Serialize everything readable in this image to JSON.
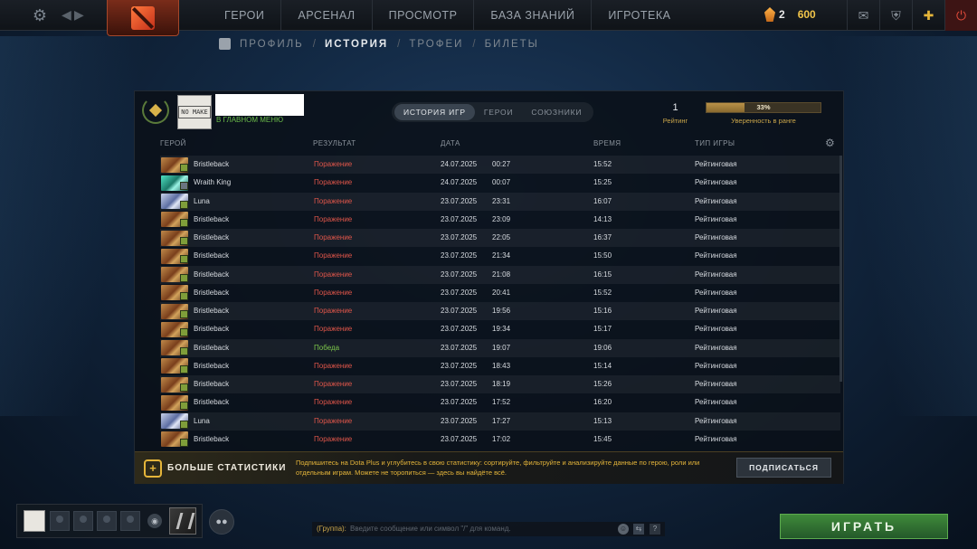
{
  "topbar": {
    "nav": [
      "ГЕРОИ",
      "АРСЕНАЛ",
      "ПРОСМОТР",
      "БАЗА ЗНАНИЙ",
      "ИГРОТЕКА"
    ],
    "shards_count": "2",
    "gold": "600"
  },
  "subnav": {
    "profile": "ПРОФИЛЬ",
    "history": "ИСТОРИЯ",
    "trophies": "ТРОФЕИ",
    "tickets": "БИЛЕТЫ",
    "sep": "/"
  },
  "player": {
    "status": "В ГЛАВНОМ МЕНЮ",
    "avatar_text": "NO MAKE"
  },
  "tabs": [
    "ИСТОРИЯ ИГР",
    "ГЕРОИ",
    "СОЮЗНИКИ"
  ],
  "rating": {
    "value": "1",
    "label": "Рейтинг"
  },
  "confidence": {
    "percent_text": "33%",
    "fraction": 0.33,
    "label": "Уверенность в ранге"
  },
  "columns": {
    "hero": "ГЕРОЙ",
    "result": "РЕЗУЛЬТАТ",
    "date": "ДАТА",
    "duration": "ВРЕМЯ",
    "type": "ТИП ИГРЫ"
  },
  "matches": [
    {
      "hero": "Bristleback",
      "img": "bristleback",
      "result": "Поражение",
      "win": false,
      "date": "24.07.2025",
      "time": "00:27",
      "duration": "15:52",
      "type": "Рейтинговая"
    },
    {
      "hero": "Wraith King",
      "img": "wraith",
      "result": "Поражение",
      "win": false,
      "date": "24.07.2025",
      "time": "00:07",
      "duration": "15:25",
      "type": "Рейтинговая"
    },
    {
      "hero": "Luna",
      "img": "luna",
      "result": "Поражение",
      "win": false,
      "date": "23.07.2025",
      "time": "23:31",
      "duration": "16:07",
      "type": "Рейтинговая"
    },
    {
      "hero": "Bristleback",
      "img": "bristleback",
      "result": "Поражение",
      "win": false,
      "date": "23.07.2025",
      "time": "23:09",
      "duration": "14:13",
      "type": "Рейтинговая"
    },
    {
      "hero": "Bristleback",
      "img": "bristleback",
      "result": "Поражение",
      "win": false,
      "date": "23.07.2025",
      "time": "22:05",
      "duration": "16:37",
      "type": "Рейтинговая"
    },
    {
      "hero": "Bristleback",
      "img": "bristleback",
      "result": "Поражение",
      "win": false,
      "date": "23.07.2025",
      "time": "21:34",
      "duration": "15:50",
      "type": "Рейтинговая"
    },
    {
      "hero": "Bristleback",
      "img": "bristleback",
      "result": "Поражение",
      "win": false,
      "date": "23.07.2025",
      "time": "21:08",
      "duration": "16:15",
      "type": "Рейтинговая"
    },
    {
      "hero": "Bristleback",
      "img": "bristleback",
      "result": "Поражение",
      "win": false,
      "date": "23.07.2025",
      "time": "20:41",
      "duration": "15:52",
      "type": "Рейтинговая"
    },
    {
      "hero": "Bristleback",
      "img": "bristleback",
      "result": "Поражение",
      "win": false,
      "date": "23.07.2025",
      "time": "19:56",
      "duration": "15:16",
      "type": "Рейтинговая"
    },
    {
      "hero": "Bristleback",
      "img": "bristleback",
      "result": "Поражение",
      "win": false,
      "date": "23.07.2025",
      "time": "19:34",
      "duration": "15:17",
      "type": "Рейтинговая"
    },
    {
      "hero": "Bristleback",
      "img": "bristleback",
      "result": "Победа",
      "win": true,
      "date": "23.07.2025",
      "time": "19:07",
      "duration": "19:06",
      "type": "Рейтинговая"
    },
    {
      "hero": "Bristleback",
      "img": "bristleback",
      "result": "Поражение",
      "win": false,
      "date": "23.07.2025",
      "time": "18:43",
      "duration": "15:14",
      "type": "Рейтинговая"
    },
    {
      "hero": "Bristleback",
      "img": "bristleback",
      "result": "Поражение",
      "win": false,
      "date": "23.07.2025",
      "time": "18:19",
      "duration": "15:26",
      "type": "Рейтинговая"
    },
    {
      "hero": "Bristleback",
      "img": "bristleback",
      "result": "Поражение",
      "win": false,
      "date": "23.07.2025",
      "time": "17:52",
      "duration": "16:20",
      "type": "Рейтинговая"
    },
    {
      "hero": "Luna",
      "img": "luna",
      "result": "Поражение",
      "win": false,
      "date": "23.07.2025",
      "time": "17:27",
      "duration": "15:13",
      "type": "Рейтинговая"
    },
    {
      "hero": "Bristleback",
      "img": "bristleback",
      "result": "Поражение",
      "win": false,
      "date": "23.07.2025",
      "time": "17:02",
      "duration": "15:45",
      "type": "Рейтинговая"
    }
  ],
  "plus_banner": {
    "title": "БОЛЬШЕ СТАТИСТИКИ",
    "description": "Подпишитесь на Dota Plus и углубитесь в свою статистику: сортируйте, фильтруйте и анализируйте данные по герою, роли или отдельным играм. Можете не торопиться — здесь вы найдёте всё.",
    "button": "ПОДПИСАТЬСЯ"
  },
  "chat": {
    "channel": "(Группа):",
    "placeholder": "Введите сообщение или символ \"/\" для команд.",
    "help": "?"
  },
  "play_button": "ИГРАТЬ",
  "colors": {
    "loss": "#e0564a",
    "win": "#7cc64a",
    "gold": "#e5b53a",
    "play": "#3f8a3a"
  }
}
